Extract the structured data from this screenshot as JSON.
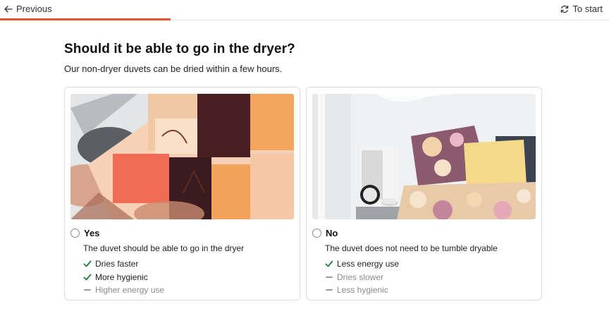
{
  "nav": {
    "previous_label": "Previous",
    "to_start_label": "To start",
    "progress": 0.28
  },
  "question": {
    "title": "Should it be able to go in the dryer?",
    "subtitle": "Our non-dryer duvets can be dried within a few hours."
  },
  "options": [
    {
      "label": "Yes",
      "description": "The duvet should be able to go in the dryer",
      "selected": false,
      "features": [
        {
          "text": "Dries faster",
          "type": "pro"
        },
        {
          "text": "More hygienic",
          "type": "pro"
        },
        {
          "text": "Higher energy use",
          "type": "con"
        }
      ]
    },
    {
      "label": "No",
      "description": "The duvet does not need to be tumble dryable",
      "selected": false,
      "features": [
        {
          "text": "Less energy use",
          "type": "pro"
        },
        {
          "text": "Dries slower",
          "type": "con"
        },
        {
          "text": "Less hygienic",
          "type": "con"
        }
      ]
    }
  ],
  "colors": {
    "accent": "#e4572e",
    "check": "#1a7f3c",
    "muted": "#8c8c8c"
  }
}
